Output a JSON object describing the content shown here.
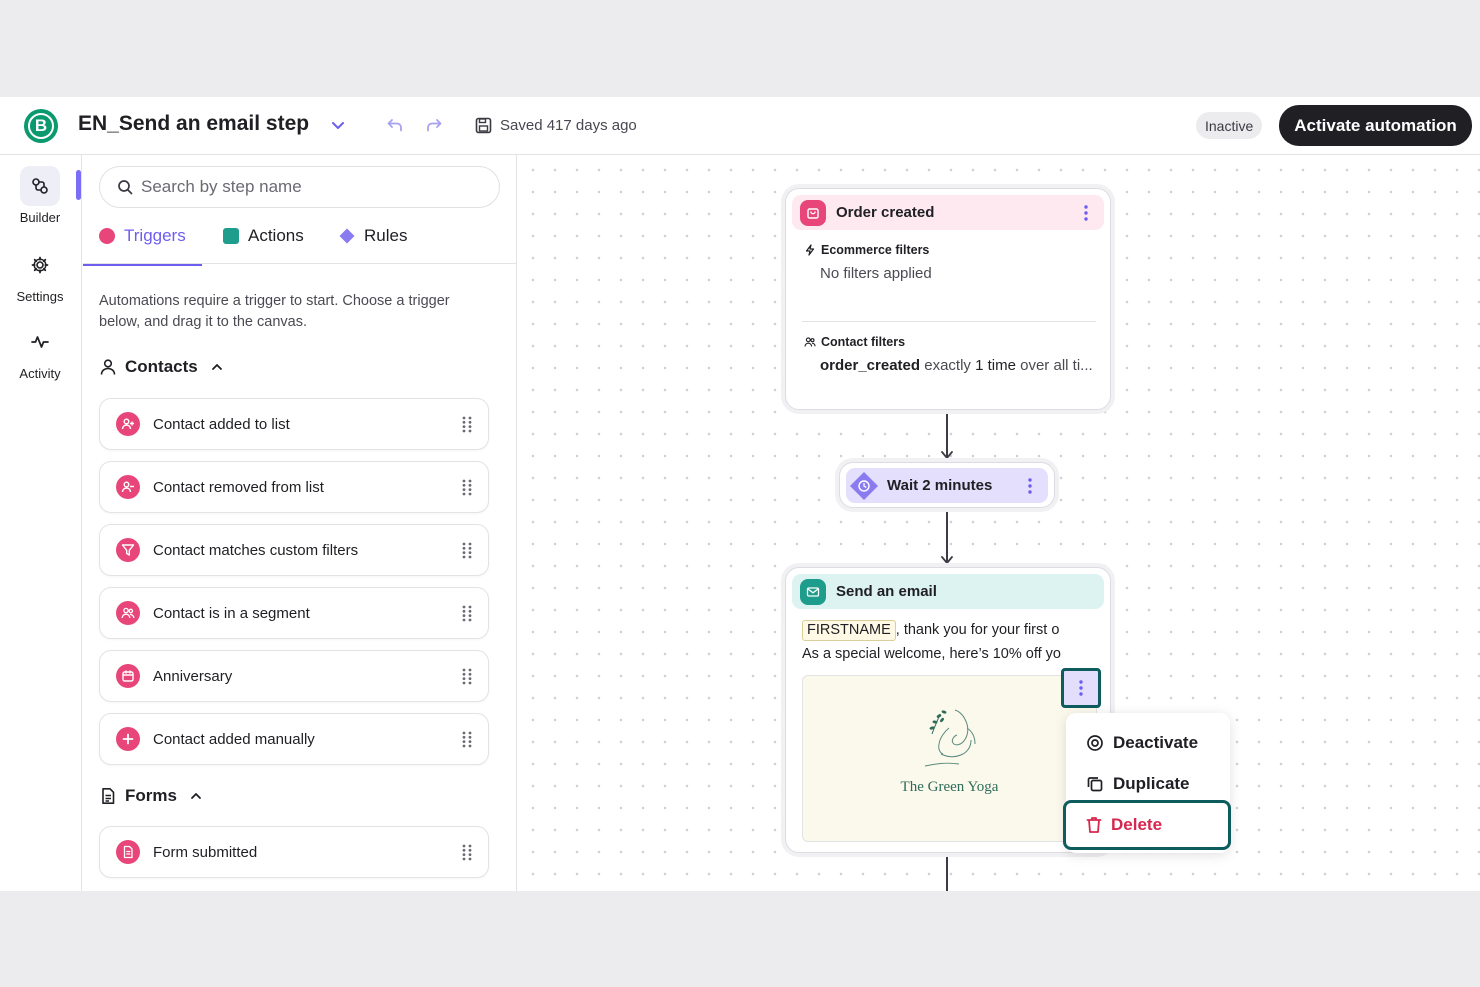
{
  "header": {
    "logo_letter": "B",
    "title": "EN_Send an email step",
    "saved_status": "Saved 417 days ago",
    "status_badge": "Inactive",
    "activate_label": "Activate automation"
  },
  "left_nav": {
    "items": [
      {
        "label": "Builder",
        "icon": "builder-icon"
      },
      {
        "label": "Settings",
        "icon": "gear-icon"
      },
      {
        "label": "Activity",
        "icon": "activity-icon"
      }
    ]
  },
  "panel": {
    "search_placeholder": "Search by step name",
    "tabs": [
      {
        "label": "Triggers",
        "color": "#e8467a"
      },
      {
        "label": "Actions",
        "color": "#1e9c8c"
      },
      {
        "label": "Rules",
        "color": "#8a7cf0"
      }
    ],
    "description": "Automations require a trigger to start. Choose a trigger below, and drag it to the canvas.",
    "sections": [
      {
        "title": "Contacts",
        "items": [
          {
            "label": "Contact added to list",
            "icon": "user-plus-icon"
          },
          {
            "label": "Contact removed from list",
            "icon": "user-minus-icon"
          },
          {
            "label": "Contact matches custom filters",
            "icon": "filter-icon"
          },
          {
            "label": "Contact is in a segment",
            "icon": "users-icon"
          },
          {
            "label": "Anniversary",
            "icon": "calendar-icon"
          },
          {
            "label": "Contact added manually",
            "icon": "plus-icon"
          }
        ]
      },
      {
        "title": "Forms",
        "items": [
          {
            "label": "Form submitted",
            "icon": "form-icon"
          }
        ]
      }
    ]
  },
  "canvas": {
    "trigger_node": {
      "title": "Order created",
      "ecommerce_filters_label": "Ecommerce filters",
      "ecommerce_filters_value": "No filters applied",
      "contact_filters_label": "Contact filters",
      "contact_filter": {
        "event": "order_created",
        "op1": "exactly",
        "count": "1 time",
        "op2": "over all ti..."
      }
    },
    "wait_node": {
      "title": "Wait 2 minutes"
    },
    "email_node": {
      "title": "Send an email",
      "chip": "FIRSTNAME",
      "line1_rest": ", thank you for your first o",
      "line2": "As a special welcome, here’s 10% off yo",
      "brand": "The Green Yoga"
    },
    "context_menu": {
      "items": [
        {
          "label": "Deactivate",
          "icon": "deactivate-icon"
        },
        {
          "label": "Duplicate",
          "icon": "duplicate-icon"
        },
        {
          "label": "Delete",
          "icon": "trash-icon"
        }
      ]
    },
    "colors": {
      "trigger_head": "#fde9ef",
      "wait_head": "#e4dffc",
      "email_head": "#dcf3f1",
      "highlight": "#0f5c5e"
    }
  }
}
